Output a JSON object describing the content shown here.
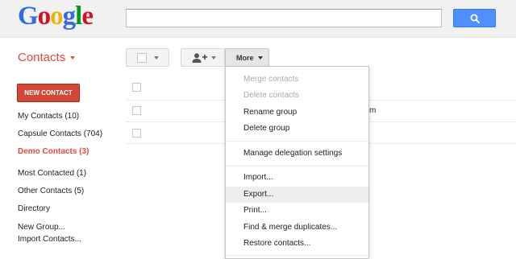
{
  "brand": {
    "letters": [
      {
        "ch": "G",
        "color": "#3369e8"
      },
      {
        "ch": "o",
        "color": "#d50f25"
      },
      {
        "ch": "o",
        "color": "#eeb211"
      },
      {
        "ch": "g",
        "color": "#3369e8"
      },
      {
        "ch": "l",
        "color": "#009925"
      },
      {
        "ch": "e",
        "color": "#d50f25"
      }
    ]
  },
  "search": {
    "value": "",
    "icon": "search-icon"
  },
  "app": {
    "title": "Contacts"
  },
  "toolbar": {
    "more_label": "More"
  },
  "sidebar": {
    "new_contact_label": "NEW CONTACT",
    "groups": [
      {
        "label": "My Contacts (10)",
        "active": false
      },
      {
        "label": "Capsule Contacts (704)",
        "active": false
      },
      {
        "label": "Demo Contacts (3)",
        "active": true
      }
    ],
    "lists": [
      {
        "label": "Most Contacted (1)"
      },
      {
        "label": "Other Contacts (5)"
      },
      {
        "label": "Directory"
      }
    ],
    "actions": [
      {
        "label": "New Group..."
      },
      {
        "label": "Import Contacts..."
      }
    ]
  },
  "contacts": {
    "visible_fragment": "m"
  },
  "more_menu": {
    "items": [
      {
        "label": "Merge contacts",
        "disabled": true
      },
      {
        "label": "Delete contacts",
        "disabled": true
      },
      {
        "label": "Rename group",
        "disabled": false
      },
      {
        "label": "Delete group",
        "disabled": false
      },
      {
        "label": "Manage delegation settings",
        "disabled": false
      },
      {
        "label": "Import...",
        "disabled": false
      },
      {
        "label": "Export...",
        "disabled": false,
        "highlighted": true
      },
      {
        "label": "Print...",
        "disabled": false
      },
      {
        "label": "Find & merge duplicates...",
        "disabled": false
      },
      {
        "label": "Restore contacts...",
        "disabled": false
      }
    ]
  },
  "colors": {
    "accent_red": "#dd4b39",
    "button_red": "#d14836",
    "search_blue": "#4d90fe"
  }
}
